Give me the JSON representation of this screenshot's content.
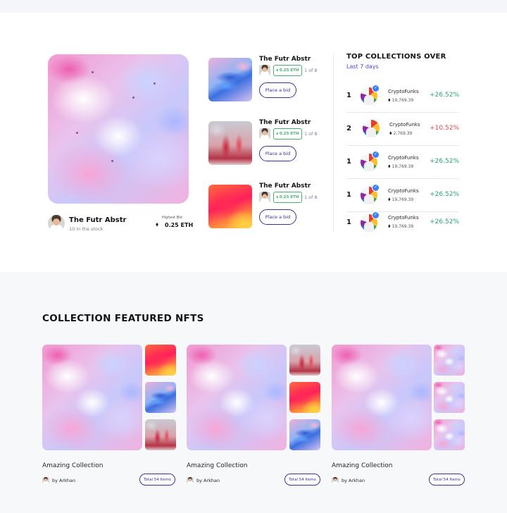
{
  "featured": {
    "title": "The Futr Abstr",
    "stock": "10 in the stock",
    "bid_label": "Highest Bid",
    "bid_value": "0.25 ETH"
  },
  "items": [
    {
      "title": "The Futr Abstr",
      "eth": "0.25 ETH",
      "edition": "1 of 8",
      "button": "Place a bid",
      "art": "art-blue"
    },
    {
      "title": "The Futr Abstr",
      "eth": "0.25 ETH",
      "edition": "1 of 8",
      "button": "Place a bid",
      "art": "art-red"
    },
    {
      "title": "The Futr Abstr",
      "eth": "0.25 ETH",
      "edition": "1 of 8",
      "button": "Place a bid",
      "art": "art-orange"
    }
  ],
  "top_collections": {
    "title": "TOP COLLECTIONS OVER",
    "subtitle": "Last 7 days",
    "rows": [
      {
        "rank": "1",
        "name": "CryptoFunks",
        "value": "19,769.39",
        "change": "+26.52%",
        "trend": "up",
        "verified": true
      },
      {
        "rank": "2",
        "name": "CryptoFunks",
        "value": "2,769.39",
        "change": "+10.52%",
        "trend": "down",
        "verified": false
      },
      {
        "rank": "1",
        "name": "CryptoFunks",
        "value": "19,769.39",
        "change": "+26.52%",
        "trend": "up",
        "verified": true
      },
      {
        "rank": "1",
        "name": "CryptoFunks",
        "value": "19,769.39",
        "change": "+26.52%",
        "trend": "up",
        "verified": true
      },
      {
        "rank": "1",
        "name": "CryptoFunks",
        "value": "19,769.39",
        "change": "+26.52%",
        "trend": "up",
        "verified": true
      }
    ]
  },
  "collections_section": {
    "title": "COLLECTION FEATURED NFTS",
    "cards": [
      {
        "name": "Amazing Collection",
        "by": "by Arkhan",
        "total": "Total 54 Items"
      },
      {
        "name": "Amazing Collection",
        "by": "by Arkhan",
        "total": "Total 54 Items"
      },
      {
        "name": "Amazing Collection",
        "by": "by Arkhan",
        "total": "Total 54 Items"
      }
    ]
  },
  "colors": {
    "accent": "#3d2f9a",
    "purple_text": "#5b3ad6",
    "positive": "#26a17b",
    "negative": "#e5484d",
    "eth_badge": "#45b26b"
  },
  "icons": {
    "eth": "ethereum-icon",
    "verified": "verified-badge-icon"
  }
}
